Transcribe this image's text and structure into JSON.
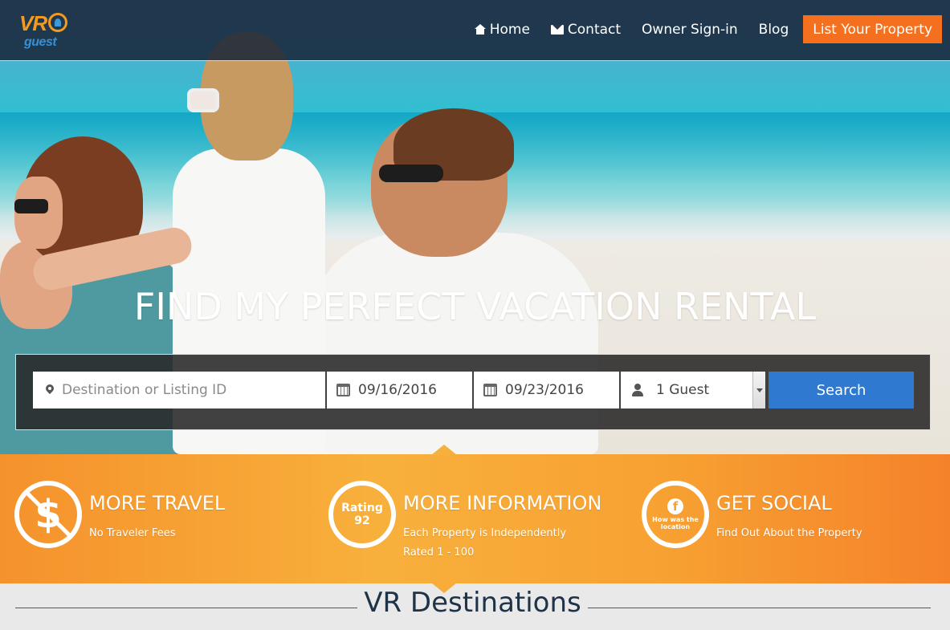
{
  "brand": {
    "logo_text": "VR",
    "logo_subtext": "guest",
    "accent_color": "#f4701f",
    "search_button_color": "#2f7ad0"
  },
  "nav": {
    "items": [
      {
        "label": "Home",
        "icon": "home-icon"
      },
      {
        "label": "Contact",
        "icon": "envelope-icon"
      },
      {
        "label": "Owner Sign-in"
      },
      {
        "label": "Blog"
      }
    ],
    "cta_label": "List Your Property"
  },
  "hero": {
    "headline": "FIND MY PERFECT VACATION RENTAL"
  },
  "search": {
    "destination_placeholder": "Destination or Listing ID",
    "checkin": "09/16/2016",
    "checkout": "09/23/2016",
    "guests_selected": "1 Guest",
    "button_label": "Search"
  },
  "features": [
    {
      "title": "MORE TRAVEL",
      "description": "No Traveler Fees",
      "icon": "no-fees-icon"
    },
    {
      "title": "MORE INFORMATION",
      "description": "Each Property is Independently Rated 1 - 100",
      "icon": "rating-badge-icon",
      "badge_label": "Rating",
      "badge_value": "92"
    },
    {
      "title": "GET SOCIAL",
      "description": "Find Out About the Property",
      "icon": "facebook-icon",
      "badge_label": "How was the location"
    }
  ],
  "destinations": {
    "title": "VR Destinations"
  }
}
